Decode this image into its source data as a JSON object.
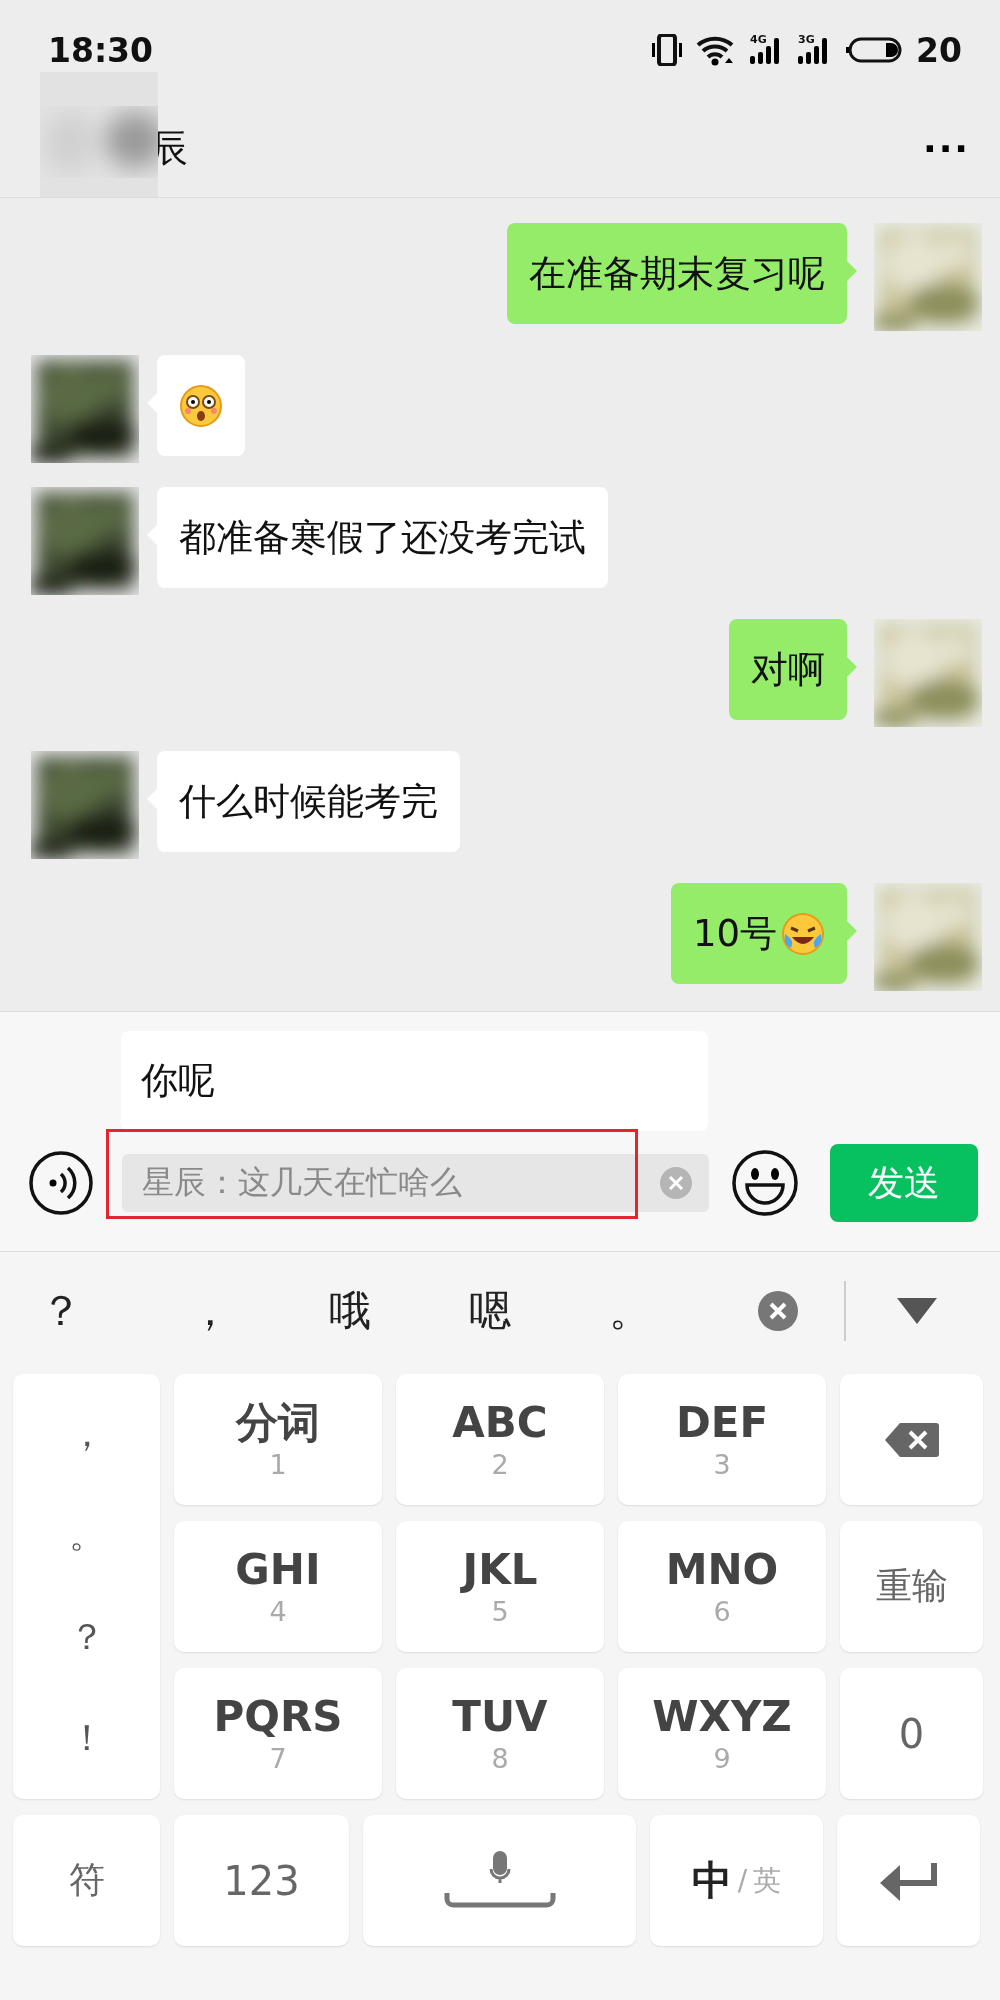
{
  "status_bar": {
    "time": "18:30",
    "signals": [
      {
        "label": "4G"
      },
      {
        "label": "3G"
      }
    ],
    "battery": "20"
  },
  "nav": {
    "title": "辰",
    "more": "···"
  },
  "messages": [
    {
      "kind": "sent",
      "text": "在准备期末复习呢",
      "emoji": false
    },
    {
      "kind": "received_sticker"
    },
    {
      "kind": "received",
      "text": "都准备寒假了还没考完试",
      "emoji": false
    },
    {
      "kind": "sent",
      "text": "对啊",
      "emoji": false
    },
    {
      "kind": "received",
      "text": "什么时候能考完",
      "emoji": false
    },
    {
      "kind": "sent",
      "text": "10号",
      "emoji": true
    }
  ],
  "input": {
    "value": "你呢",
    "quote": "星辰：这几天在忙啥么",
    "highlighted": true,
    "send": "发送"
  },
  "keyboard": {
    "candidates": [
      "？",
      "，",
      "哦",
      "嗯",
      "。"
    ],
    "side_column": [
      "，",
      "。",
      "？",
      "！"
    ],
    "keys": [
      {
        "kind": "t9",
        "label": "分词",
        "digit": "1"
      },
      {
        "kind": "t9",
        "label": "ABC",
        "digit": "2"
      },
      {
        "kind": "t9",
        "label": "DEF",
        "digit": "3"
      },
      {
        "kind": "backspace"
      },
      {
        "kind": "t9",
        "label": "GHI",
        "digit": "4"
      },
      {
        "kind": "t9",
        "label": "JKL",
        "digit": "5"
      },
      {
        "kind": "t9",
        "label": "MNO",
        "digit": "6"
      },
      {
        "kind": "text",
        "label": "重输"
      },
      {
        "kind": "t9",
        "label": "PQRS",
        "digit": "7"
      },
      {
        "kind": "t9",
        "label": "TUV",
        "digit": "8"
      },
      {
        "kind": "t9",
        "label": "WXYZ",
        "digit": "9"
      },
      {
        "kind": "text",
        "label": "0"
      }
    ],
    "bottom": [
      {
        "kind": "text",
        "label": "符"
      },
      {
        "kind": "text",
        "label": "123"
      },
      {
        "kind": "space"
      },
      {
        "kind": "lang",
        "label": "中",
        "separator": "/",
        "alt": "英"
      },
      {
        "kind": "enter"
      }
    ]
  }
}
